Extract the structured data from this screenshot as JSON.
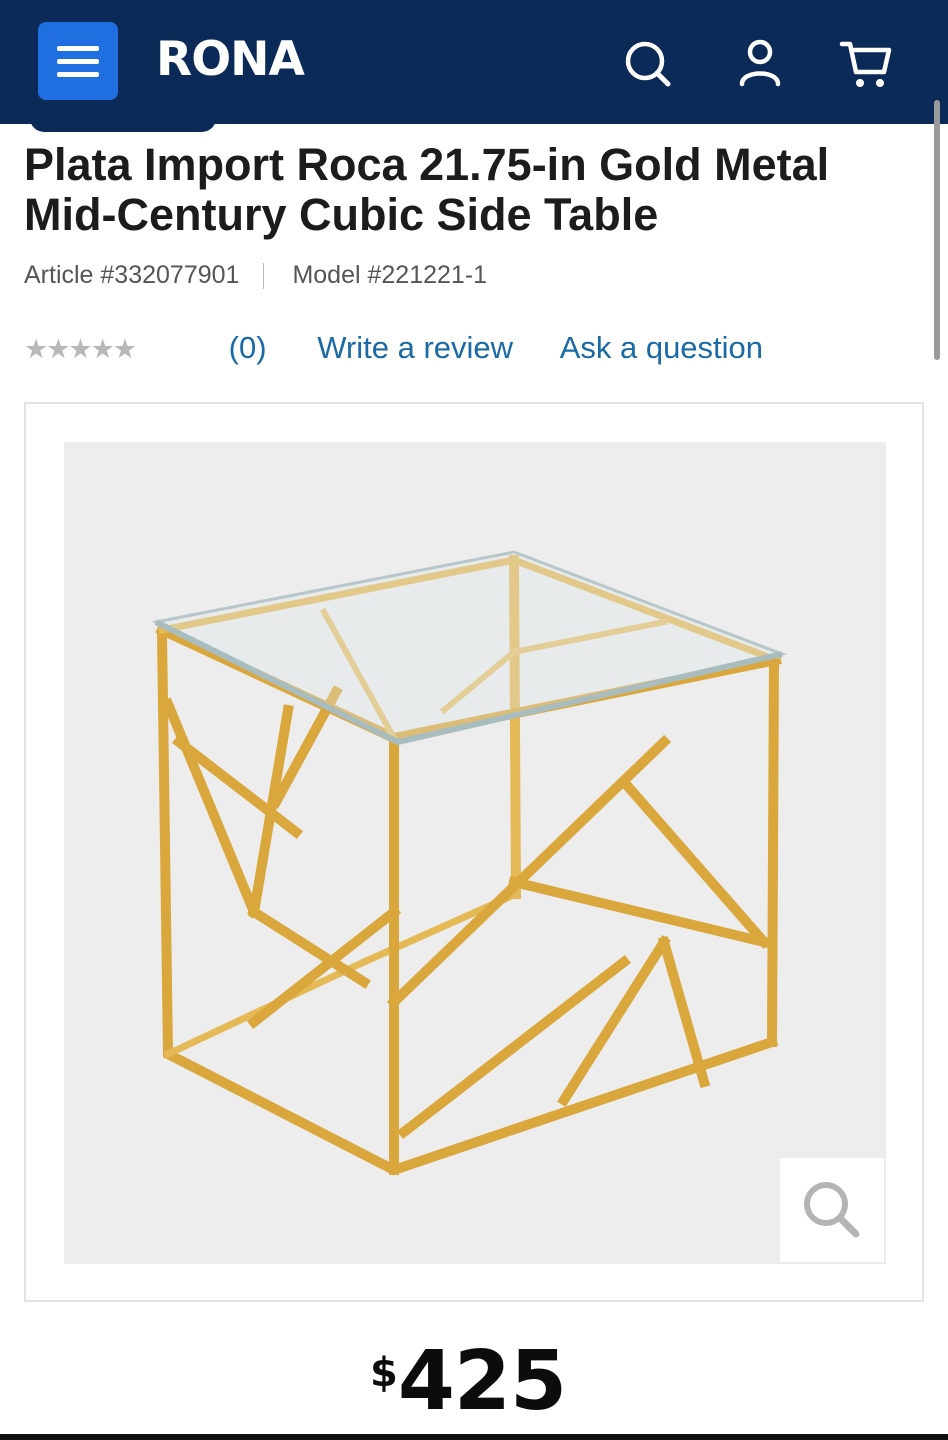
{
  "header": {
    "logo": "RONA",
    "icons": [
      "menu-icon",
      "search-icon",
      "account-icon",
      "cart-icon"
    ],
    "colors": {
      "bar": "#0b2a57",
      "menu_button": "#1f6fe0"
    }
  },
  "product": {
    "title": "Plata Import Roca 21.75-in Gold Metal Mid-Century Cubic Side Table",
    "article": "Article #332077901",
    "model": "Model #221221-1",
    "rating": {
      "stars": "★★★★★",
      "score": 0,
      "count": "(0)",
      "write_review": "Write a review",
      "ask_question": "Ask a question"
    },
    "price": {
      "currency": "$",
      "amount": "425"
    }
  },
  "colors": {
    "link": "#1a6aa6",
    "gold": "#d9a73b"
  }
}
